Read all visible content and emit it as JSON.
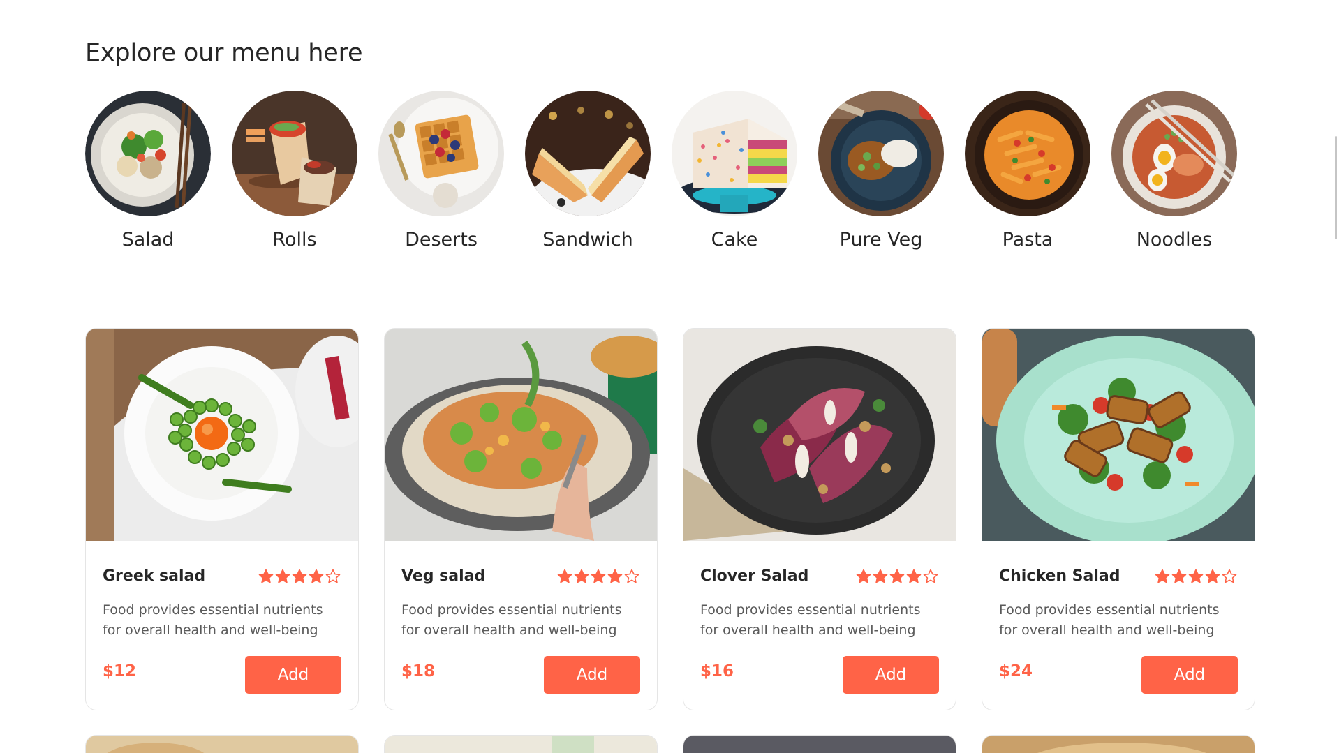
{
  "menu": {
    "heading": "Explore our menu here",
    "categories": [
      {
        "label": "Salad"
      },
      {
        "label": "Rolls"
      },
      {
        "label": "Deserts"
      },
      {
        "label": "Sandwich"
      },
      {
        "label": "Cake"
      },
      {
        "label": "Pure Veg"
      },
      {
        "label": "Pasta"
      },
      {
        "label": "Noodles"
      }
    ]
  },
  "foods": [
    {
      "name": "Greek salad",
      "rating": 4,
      "rating_max": 5,
      "description": "Food provides essential nutrients for overall health and well-being",
      "price": "$12",
      "button": "Add"
    },
    {
      "name": "Veg salad",
      "rating": 4,
      "rating_max": 5,
      "description": "Food provides essential nutrients for overall health and well-being",
      "price": "$18",
      "button": "Add"
    },
    {
      "name": "Clover Salad",
      "rating": 4,
      "rating_max": 5,
      "description": "Food provides essential nutrients for overall health and well-being",
      "price": "$16",
      "button": "Add"
    },
    {
      "name": "Chicken Salad",
      "rating": 4,
      "rating_max": 5,
      "description": "Food provides essential nutrients for overall health and well-being",
      "price": "$24",
      "button": "Add"
    }
  ],
  "theme": {
    "accent": "#ff6347",
    "text": "#262626",
    "muted_text": "#5a5a5a",
    "card_border": "#e5e5e5"
  }
}
